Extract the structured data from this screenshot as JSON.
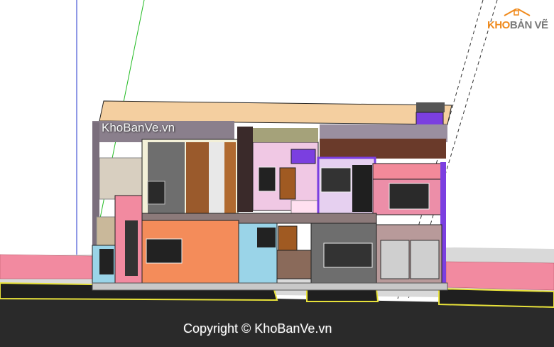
{
  "watermark_center": "KhoBanVe.vn",
  "copyright": "Copyright © KhoBanVe.vn",
  "logo": {
    "part1": "KHO",
    "part2": "BẢN VẼ"
  },
  "colors": {
    "accent_orange": "#f08a1c",
    "logo_gray": "#7a7a7a",
    "road": "#2a2a2a",
    "curb_yellow": "#e8e23a",
    "boundary_pink": "#f28aa0"
  }
}
